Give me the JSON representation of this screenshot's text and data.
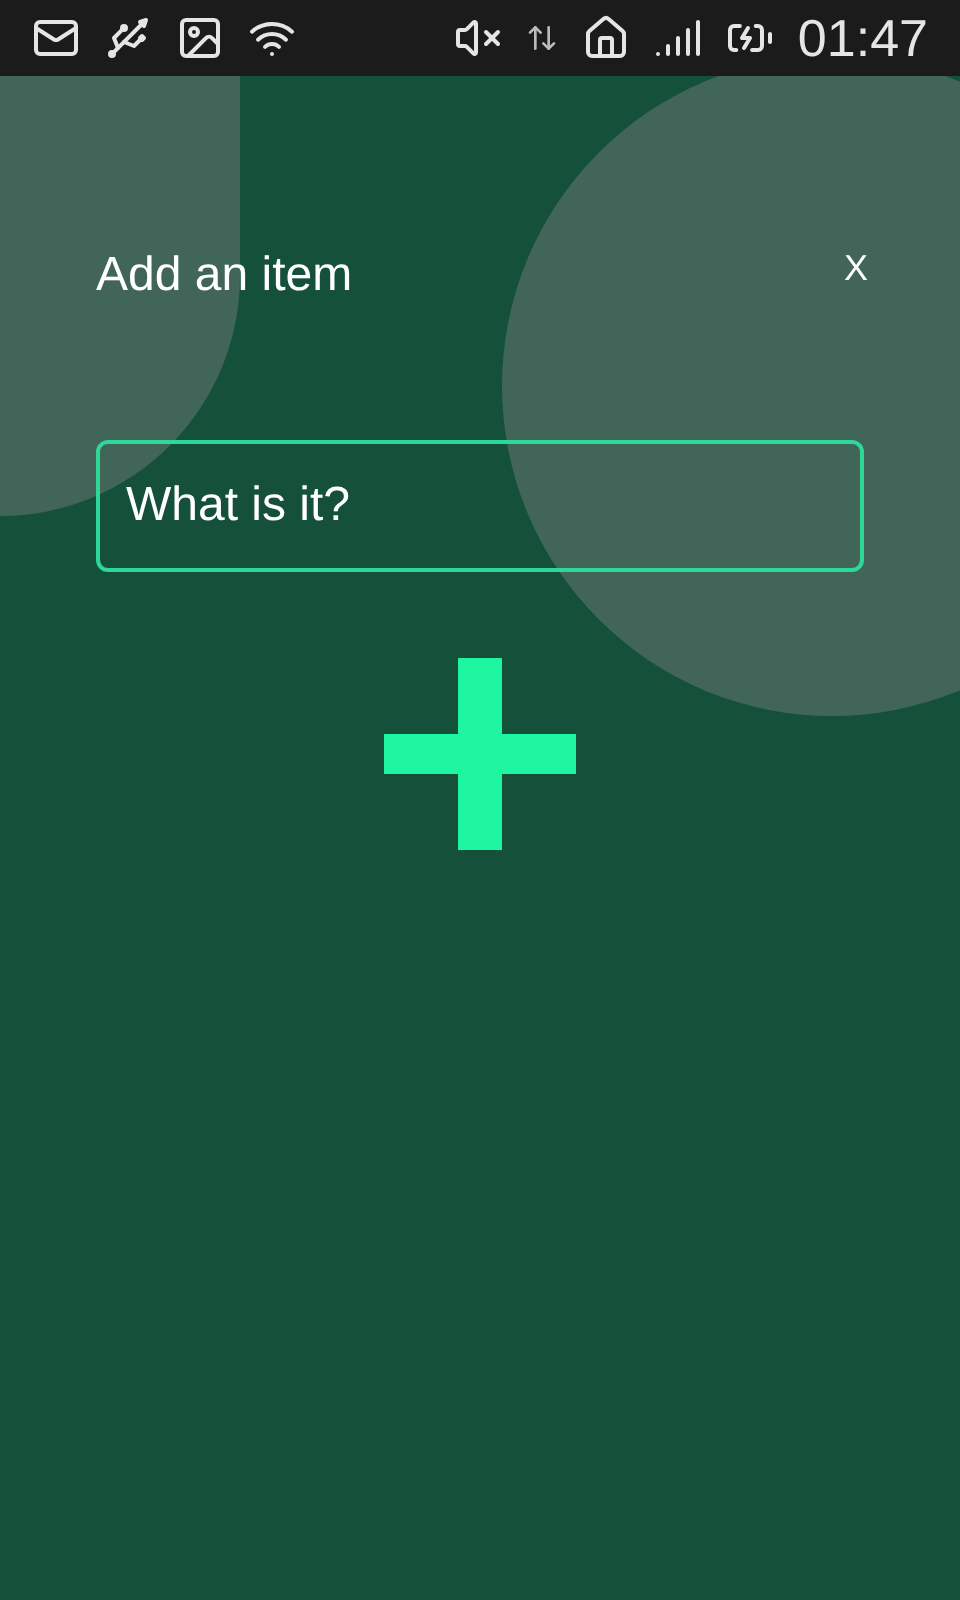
{
  "status_bar": {
    "time": "01:47"
  },
  "dialog": {
    "title": "Add an item",
    "close": "X",
    "field": {
      "placeholder": "What is it?"
    }
  }
}
